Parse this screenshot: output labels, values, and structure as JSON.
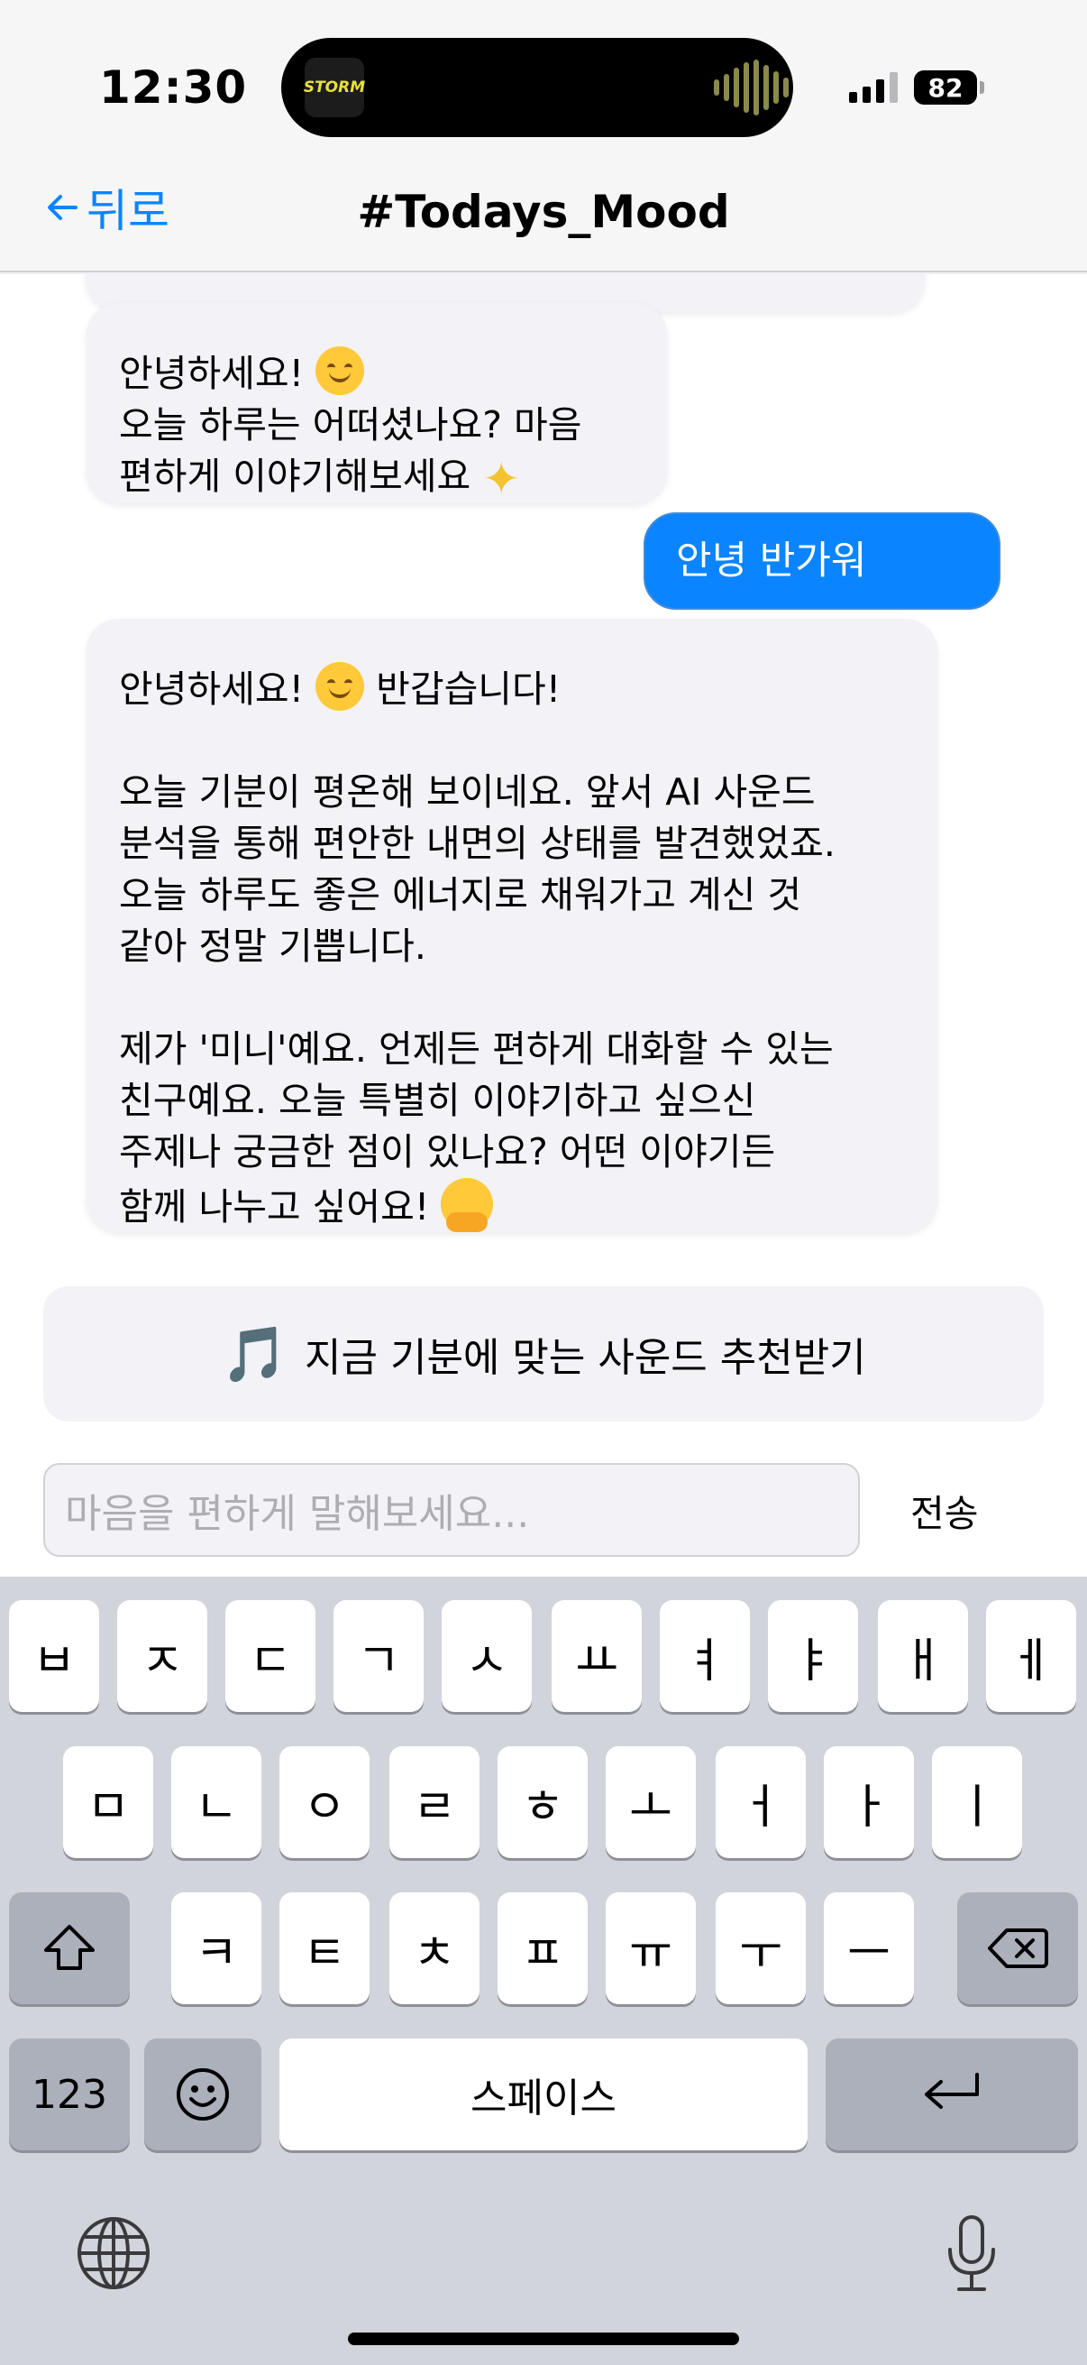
{
  "status_bar": {
    "time": "12:30",
    "island_app": "STORM",
    "battery": "82"
  },
  "nav": {
    "back_label": "뒤로",
    "title": "#Todays_Mood"
  },
  "messages": {
    "bot1_line1": "안녕하세요!",
    "bot1_line2": "오늘 하루는 어떠셨나요? 마음",
    "bot1_line3": "편하게 이야기해보세요",
    "user1": "안녕 반가워",
    "bot2_greeting": "안녕하세요!",
    "bot2_greeting_tail": "반갑습니다!",
    "bot2_para1": "오늘 기분이 평온해 보이네요. 앞서 AI 사운드\n분석을 통해 편안한 내면의 상태를 발견했었죠.\n오늘 하루도 좋은 에너지로 채워가고 계신 것\n같아 정말 기쁩니다.",
    "bot2_para2": "제가 '미니'예요. 언제든 편하게 대화할 수 있는\n친구예요. 오늘 특별히 이야기하고 싶으신\n주제나 궁금한 점이 있나요? 어떤 이야기든\n함께 나누고 싶어요!"
  },
  "recommend_button": {
    "icon": "🎵",
    "label": "지금 기분에 맞는 사운드 추천받기"
  },
  "composer": {
    "placeholder": "마음을 편하게 말해보세요...",
    "send_label": "전송"
  },
  "keyboard": {
    "row1": [
      "ㅂ",
      "ㅈ",
      "ㄷ",
      "ㄱ",
      "ㅅ",
      "ㅛ",
      "ㅕ",
      "ㅑ",
      "ㅐ",
      "ㅔ"
    ],
    "row2": [
      "ㅁ",
      "ㄴ",
      "ㅇ",
      "ㄹ",
      "ㅎ",
      "ㅗ",
      "ㅓ",
      "ㅏ",
      "ㅣ"
    ],
    "row3": [
      "ㅋ",
      "ㅌ",
      "ㅊ",
      "ㅍ",
      "ㅠ",
      "ㅜ",
      "ㅡ"
    ],
    "numbers_label": "123",
    "space_label": "스페이스"
  },
  "colors": {
    "accent": "#0a84ff",
    "bubble_bot": "#f2f2f7",
    "keyboard_bg": "#d1d4db"
  }
}
